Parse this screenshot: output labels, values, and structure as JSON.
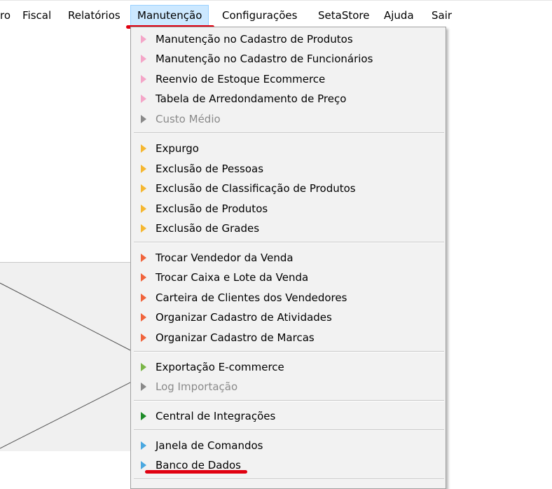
{
  "menubar": {
    "items": [
      {
        "label": "ro"
      },
      {
        "label": "Fiscal"
      },
      {
        "label": "Relatórios"
      },
      {
        "label": "Manutenção"
      },
      {
        "label": "Configurações"
      },
      {
        "label": "SetaStore"
      },
      {
        "label": "Ajuda"
      },
      {
        "label": "Sair"
      }
    ]
  },
  "dropdown": {
    "groups": [
      {
        "color": "#f4a6c8",
        "items": [
          {
            "label": "Manutenção no Cadastro de Produtos",
            "enabled": true
          },
          {
            "label": "Manutenção no Cadastro de Funcionários",
            "enabled": true
          },
          {
            "label": "Reenvio de Estoque Ecommerce",
            "enabled": true
          },
          {
            "label": "Tabela de Arredondamento de Preço",
            "enabled": true
          },
          {
            "label": "Custo Médio",
            "enabled": false
          }
        ]
      },
      {
        "color": "#f5b731",
        "items": [
          {
            "label": "Expurgo",
            "enabled": true
          },
          {
            "label": "Exclusão de Pessoas",
            "enabled": true
          },
          {
            "label": "Exclusão de Classificação de Produtos",
            "enabled": true
          },
          {
            "label": "Exclusão de Produtos",
            "enabled": true
          },
          {
            "label": "Exclusão de Grades",
            "enabled": true
          }
        ]
      },
      {
        "color": "#f0643c",
        "items": [
          {
            "label": "Trocar Vendedor da Venda",
            "enabled": true
          },
          {
            "label": "Trocar Caixa e Lote da Venda",
            "enabled": true
          },
          {
            "label": "Carteira de Clientes dos Vendedores",
            "enabled": true
          },
          {
            "label": "Organizar Cadastro de Atividades",
            "enabled": true
          },
          {
            "label": "Organizar Cadastro de Marcas",
            "enabled": true
          }
        ]
      },
      {
        "color": "#7ab648",
        "items": [
          {
            "label": "Exportação E-commerce",
            "enabled": true
          },
          {
            "label": "Log Importação",
            "enabled": false
          }
        ]
      },
      {
        "color": "#1e8c28",
        "items": [
          {
            "label": "Central de Integrações",
            "enabled": true
          }
        ]
      },
      {
        "color": "#4aa8e0",
        "items": [
          {
            "label": "Janela de Comandos",
            "enabled": true
          },
          {
            "label": "Banco de Dados",
            "enabled": true
          }
        ]
      }
    ]
  },
  "colors": {
    "disabled_arrow": "#8a8a8a",
    "annotation": "#e00010",
    "active_menu_bg": "#cce8ff"
  }
}
